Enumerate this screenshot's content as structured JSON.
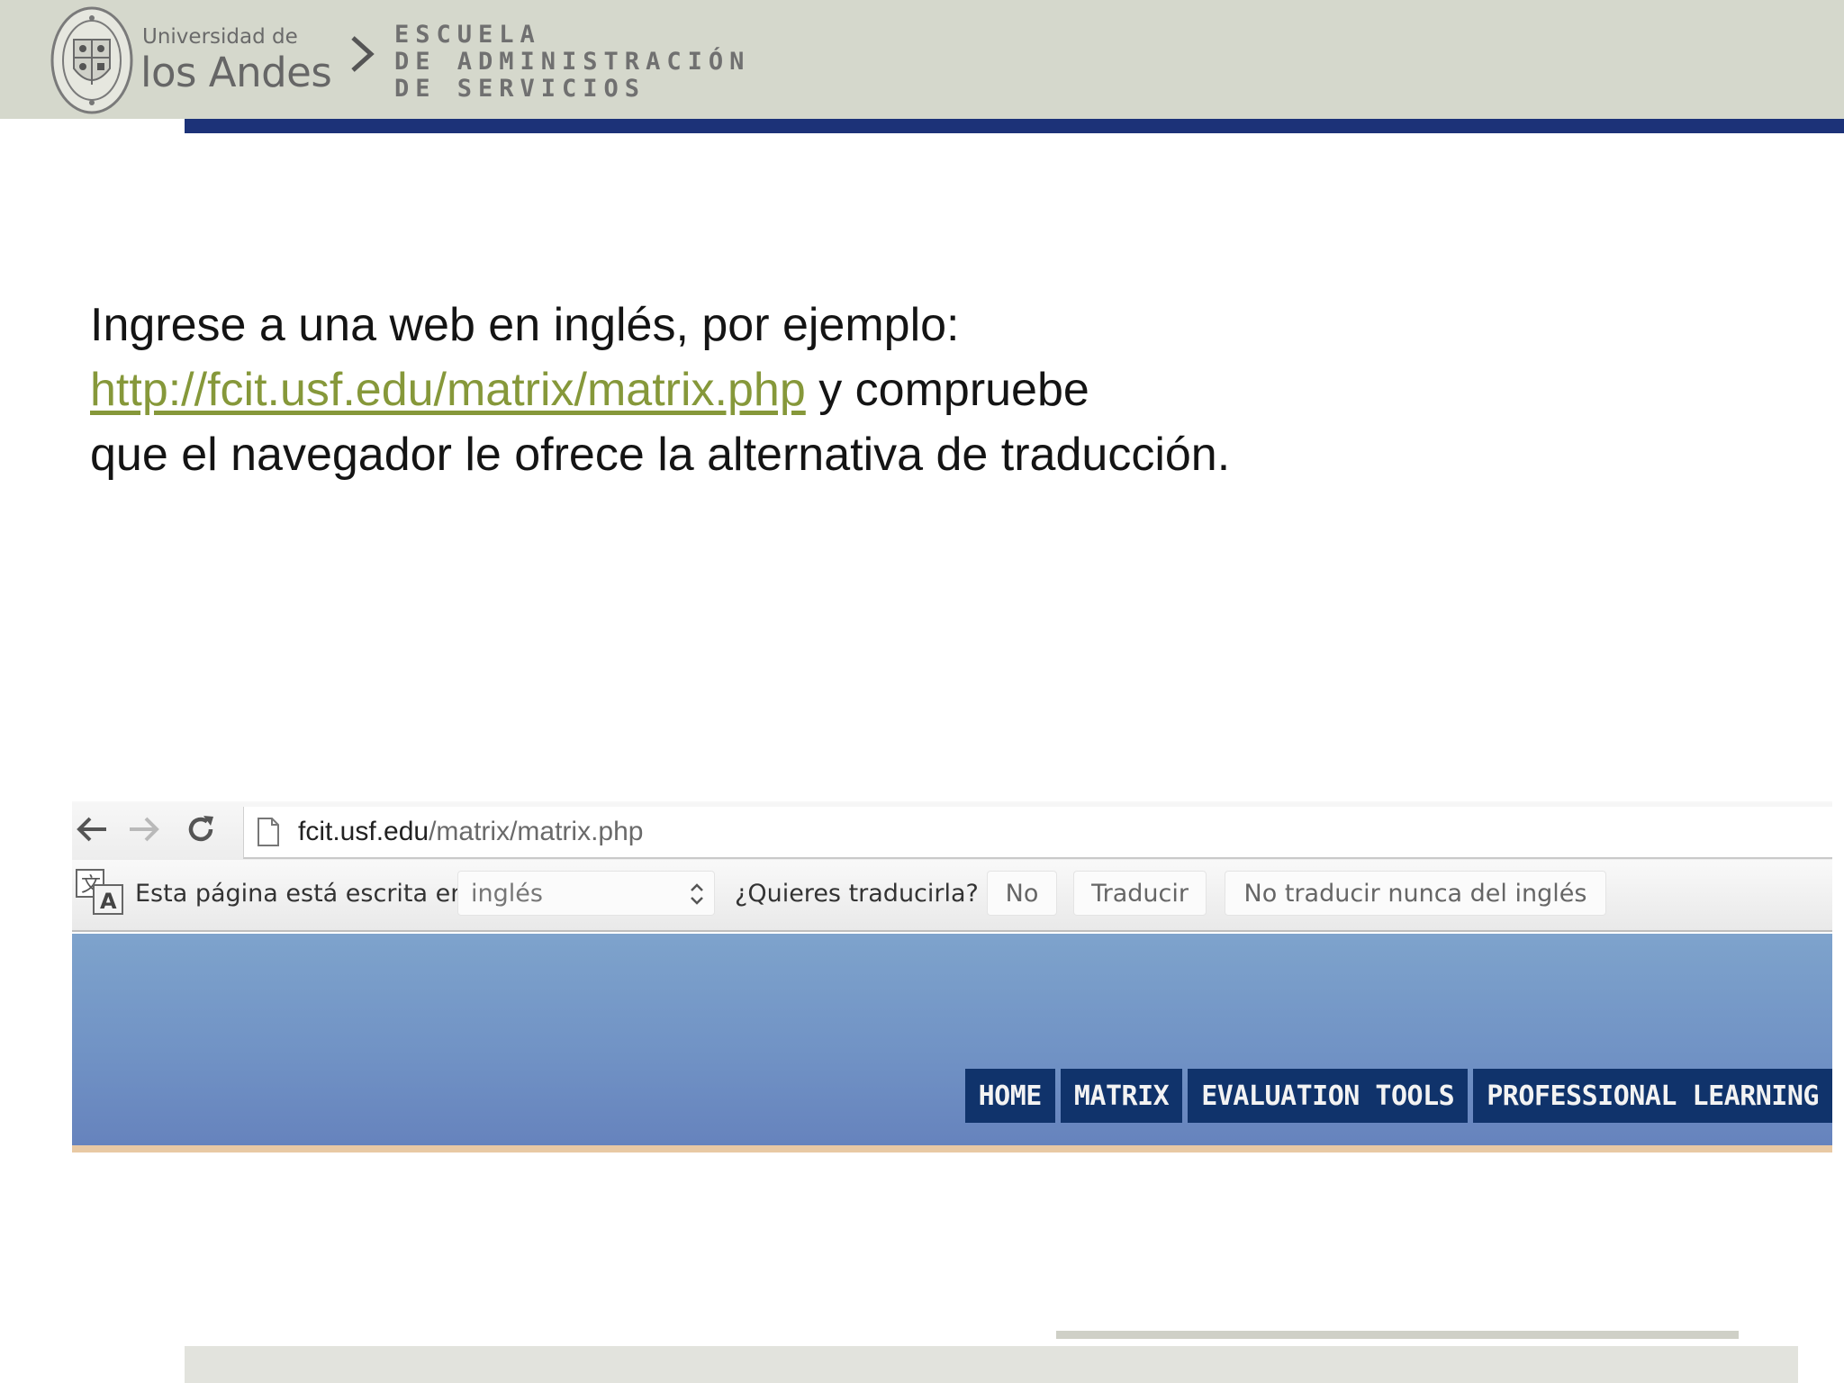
{
  "header": {
    "university_prefix": "Universidad de",
    "university_name": "los Andes",
    "school_lines": [
      "ESCUELA",
      "DE ADMINISTRACIÓN",
      "DE SERVICIOS"
    ],
    "seal_icon": "university-seal-icon",
    "separator_icon": "chevron-right-icon",
    "band_color": "#d5d8cc",
    "rule_color": "#1c3278"
  },
  "instructions": {
    "line1": "Ingrese a una web en inglés, por ejemplo:",
    "link_text": "http://fcit.usf.edu/matrix/matrix.php",
    "line2_suffix": " y compruebe",
    "line3": "que el navegador le ofrece la alternativa de traducción.",
    "link_color": "#86983a"
  },
  "browser": {
    "back_icon": "back-arrow-icon",
    "forward_icon": "forward-arrow-icon",
    "reload_icon": "reload-icon",
    "page_icon": "document-icon",
    "url_domain": "fcit.usf.edu",
    "url_path": "/matrix/matrix.php",
    "infobar": {
      "translate_icon": "translate-icon",
      "prefix": "Esta página está escrita en",
      "language": "inglés",
      "question": "¿Quieres traducirla?",
      "no_button": "No",
      "translate_button": "Traducir",
      "never_button": "No traducir nunca del inglés"
    },
    "site_nav": [
      "HOME",
      "MATRIX",
      "EVALUATION TOOLS",
      "PROFESSIONAL LEARNING"
    ],
    "site_nav_color": "#10336b"
  }
}
